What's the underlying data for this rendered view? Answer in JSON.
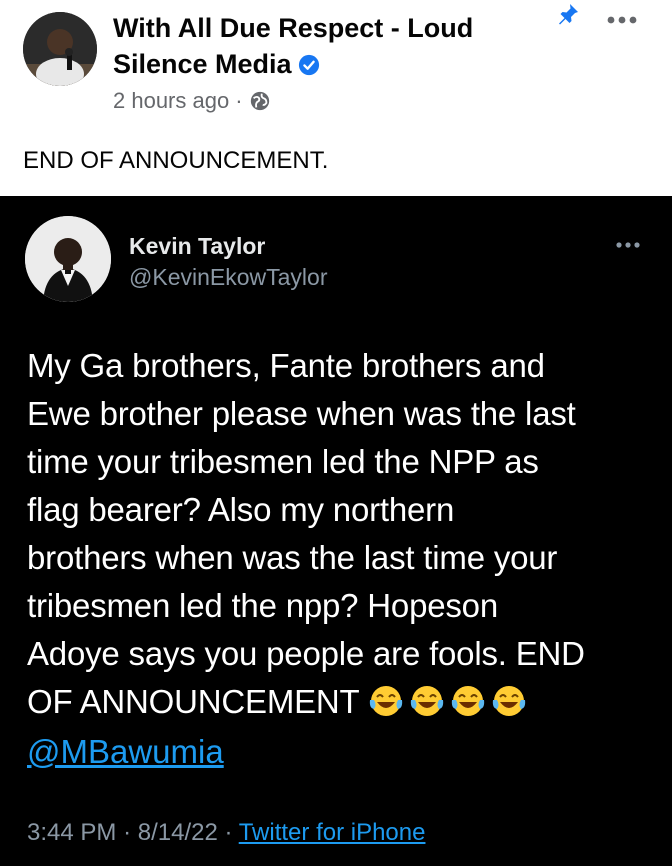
{
  "fb_post": {
    "page_name": "With All Due Respect - Loud Silence Media",
    "timestamp": "2 hours ago",
    "separator": "·",
    "text": "END OF ANNOUNCEMENT.",
    "icons": [
      "avatar",
      "verified-badge-icon",
      "globe-icon",
      "pin-icon",
      "more-options-icon"
    ],
    "colors": {
      "badge": "#1877f2",
      "pin": "#1877f2",
      "meta_text": "#65676b"
    }
  },
  "tweet": {
    "author_name": "Kevin Taylor",
    "author_handle": "@KevinEkowTaylor",
    "body_lines": [
      "My Ga brothers, Fante brothers and",
      "Ewe brother please when was the last",
      "time your tribesmen led the NPP as",
      "flag bearer? Also my northern",
      "brothers when was the last time your",
      "tribesmen led the npp? Hopeson",
      "Adoye says you people are fools. END",
      "OF ANNOUNCEMENT"
    ],
    "emoji": [
      "face-with-tears-of-joy",
      "face-with-tears-of-joy",
      "face-with-tears-of-joy",
      "face-with-tears-of-joy"
    ],
    "mention": "@MBawumia",
    "time": "3:44 PM",
    "date": "8/14/22",
    "sep": "·",
    "source": "Twitter for iPhone",
    "colors": {
      "background": "#000000",
      "link": "#1d9bf0",
      "secondary": "#8b98a5"
    }
  }
}
